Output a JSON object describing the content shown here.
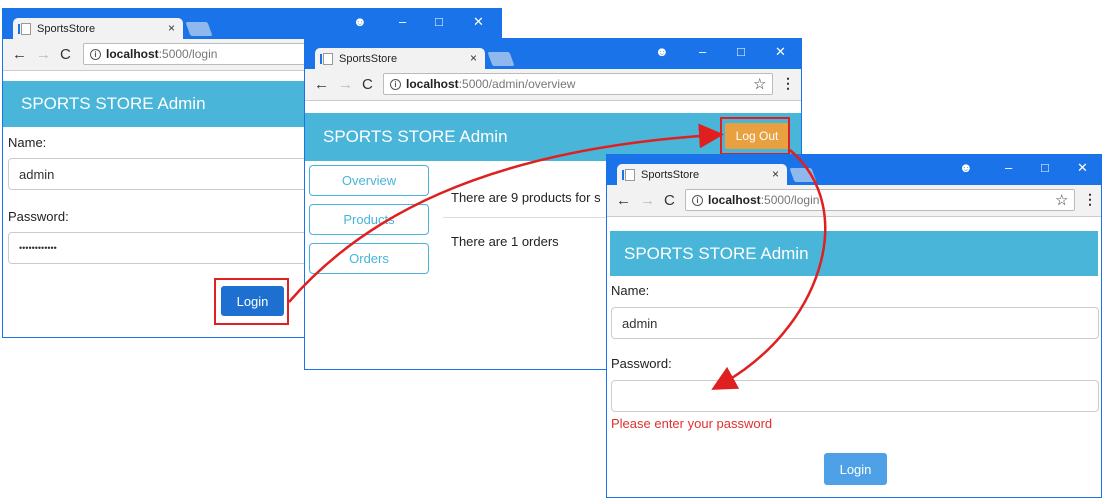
{
  "browser": {
    "tab_title": "SportsStore",
    "close_glyph": "×",
    "url_host": "localhost",
    "url_port_login": ":5000/login",
    "url_port_overview": ":5000/admin/overview",
    "minimize_glyph": "–",
    "maximize_glyph": "□",
    "window_close_glyph": "✕",
    "profile_glyph": "☻"
  },
  "banner": {
    "title": "SPORTS STORE Admin"
  },
  "login1": {
    "name_label": "Name:",
    "name_value": "admin",
    "password_label": "Password:",
    "password_value": "••••••••••••",
    "login_button": "Login"
  },
  "overview": {
    "logout_button": "Log Out",
    "nav": [
      "Overview",
      "Products",
      "Orders"
    ],
    "products_text": "There are 9 products for s",
    "orders_text": "There are 1 orders"
  },
  "login2": {
    "name_label": "Name:",
    "name_value": "admin",
    "password_label": "Password:",
    "password_value": "",
    "error": "Please enter your password",
    "login_button": "Login"
  },
  "colors": {
    "accent": "#1a73e8",
    "banner": "#48b5d9",
    "logout": "#e8a040",
    "highlight": "#e02020"
  }
}
